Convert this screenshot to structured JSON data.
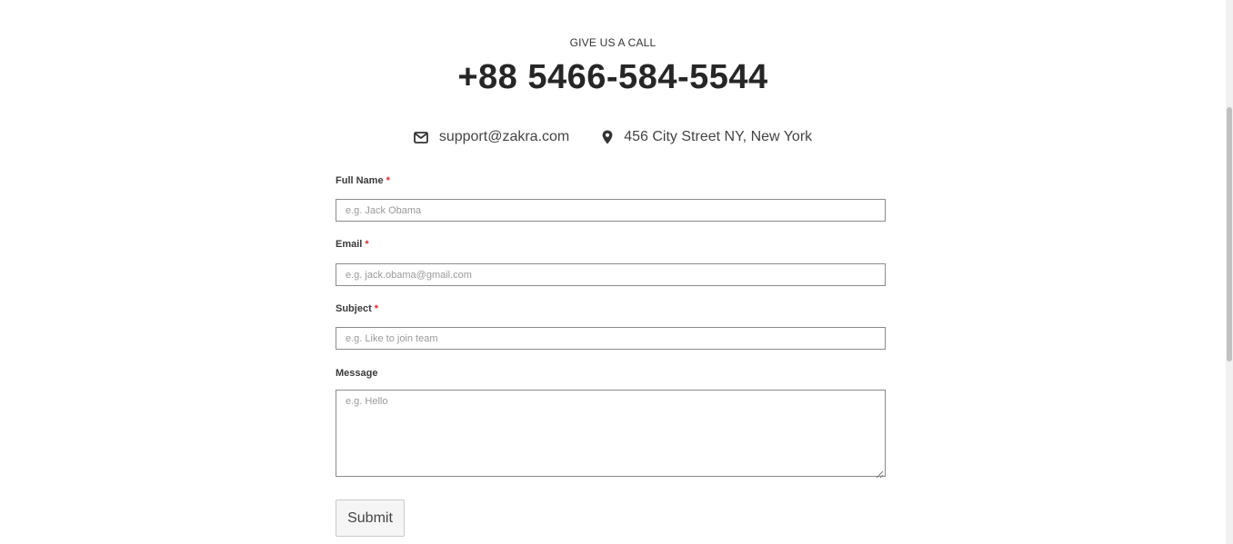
{
  "header": {
    "eyebrow": "GIVE US A CALL",
    "phone": "+88 5466-584-5544"
  },
  "contact": {
    "email": {
      "icon": "envelope-icon",
      "text": "support@zakra.com"
    },
    "address": {
      "icon": "map-marker-icon",
      "text": "456 City Street NY, New York"
    }
  },
  "form": {
    "required_mark": "*",
    "full_name": {
      "label": "Full Name",
      "required": true,
      "placeholder": "e.g. Jack Obama",
      "value": ""
    },
    "email": {
      "label": "Email",
      "required": true,
      "placeholder": "e.g. jack.obama@gmail.com",
      "value": ""
    },
    "subject": {
      "label": "Subject",
      "required": true,
      "placeholder": "e.g. Like to join team",
      "value": ""
    },
    "message": {
      "label": "Message",
      "required": false,
      "placeholder": "e.g. Hello",
      "value": ""
    },
    "submit_label": "Submit"
  },
  "colors": {
    "required": "#e0282e",
    "text_dark": "#262626",
    "input_border": "#8a8a8a"
  }
}
